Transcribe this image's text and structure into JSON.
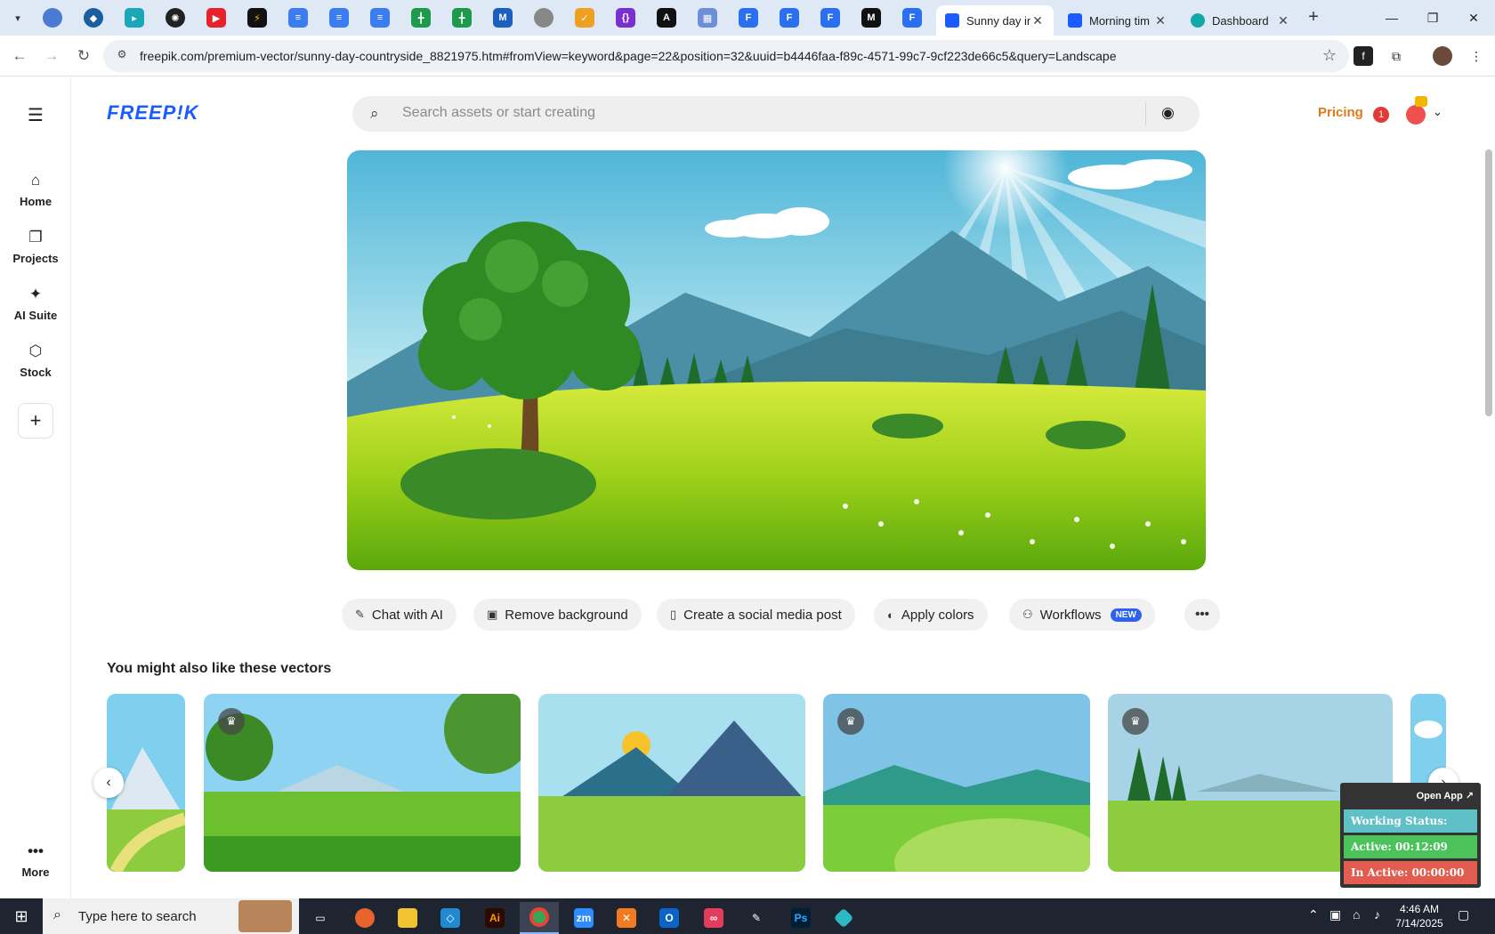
{
  "browser": {
    "tabs": [
      {
        "title": "Sunny day in",
        "active": true,
        "favicon_color": "#1a5cff"
      },
      {
        "title": "Morning tim",
        "active": false,
        "favicon_color": "#1a5cff"
      },
      {
        "title": "Dashboard",
        "active": false,
        "favicon_color": "#13a8a8"
      }
    ],
    "url": "freepik.com/premium-vector/sunny-day-countryside_8821975.htm#fromView=keyword&page=22&position=32&uuid=b4446faa-f89c-4571-99c7-9cf223de66c5&query=Landscape"
  },
  "sidebar": {
    "items": [
      {
        "label": "Home",
        "icon": "home-icon"
      },
      {
        "label": "Projects",
        "icon": "projects-icon"
      },
      {
        "label": "AI Suite",
        "icon": "ai-sparkle-icon"
      },
      {
        "label": "Stock",
        "icon": "stock-icon"
      }
    ],
    "more_label": "More"
  },
  "header": {
    "logo": "FREEP!K",
    "search_placeholder": "Search assets or start creating",
    "pricing_label": "Pricing",
    "notification_count": "1"
  },
  "actions": {
    "chat_ai": "Chat with AI",
    "remove_bg": "Remove background",
    "social_post": "Create a social media post",
    "apply_colors": "Apply colors",
    "workflows": "Workflows",
    "new_badge": "NEW"
  },
  "related": {
    "title": "You might also like these vectors"
  },
  "work_status": {
    "open_app": "Open App ↗",
    "status": "Working Status: Active",
    "active": "Active: 00:12:09",
    "inactive": "In Active: 00:00:00"
  },
  "taskbar": {
    "search_placeholder": "Type here to search",
    "time": "4:46 AM",
    "date": "7/14/2025"
  },
  "colors": {
    "brand_blue": "#1a5cff",
    "pricing_orange": "#e07b1a",
    "status_teal": "#5fc0c8",
    "status_green": "#4cc35a",
    "status_red": "#e25c4f"
  }
}
